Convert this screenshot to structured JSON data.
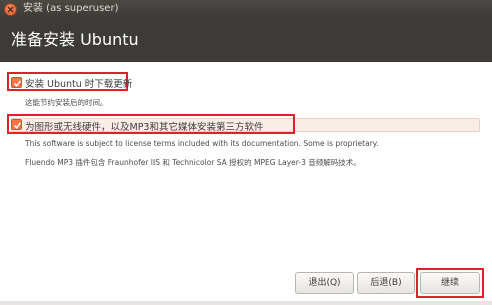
{
  "window": {
    "title": "安装 (as superuser)"
  },
  "header": {
    "title": "准备安装 Ubuntu"
  },
  "options": {
    "download_updates": {
      "label": "安装 Ubuntu 时下载更新",
      "hint": "这能节约安装后的时间。",
      "checked": true
    },
    "third_party": {
      "label": "为图形或无线硬件，以及MP3和其它媒体安装第三方软件",
      "hint1": "This software is subject to license terms included with its documentation. Some is proprietary.",
      "hint2": "Fluendo MP3 插件包含 Fraunhofer IIS 和 Technicolor SA 授权的 MPEG Layer-3 音频解码技术。",
      "checked": true
    }
  },
  "buttons": {
    "quit": "退出(Q)",
    "back": "后退(B)",
    "continue": "继续"
  },
  "colors": {
    "accent": "#f07746",
    "highlight_box": "#e0202a",
    "header_bg": "#3c3b37"
  }
}
